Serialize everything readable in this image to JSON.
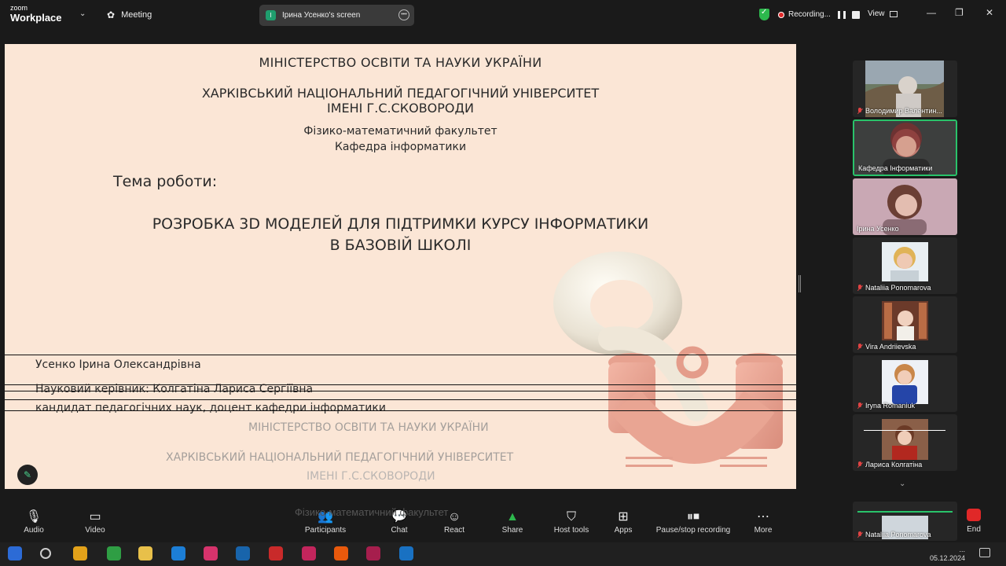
{
  "app": {
    "logo_line1": "zoom",
    "logo_line2": "Workplace",
    "meeting_label": "Meeting",
    "screen_share_badge": "I",
    "screen_share_label": "Ірина Усенко's screen",
    "recording_label": "Recording...",
    "view_label": "View",
    "accent_green": "#29c36a",
    "record_red": "#e02828"
  },
  "slide": {
    "ministry": "МІНІСТЕРСТВО ОСВІТИ ТА НАУКИ УКРАЇНИ",
    "university_line1": "ХАРКІВСЬКИЙ НАЦІОНАЛЬНИЙ ПЕДАГОГІЧНИЙ УНІВЕРСИТЕТ",
    "university_line2": "ІМЕНІ Г.С.СКОВОРОДИ",
    "faculty": "Фізико-математичний факультет",
    "department": "Кафедра інформатики",
    "topic_label": "Тема роботи:",
    "topic_line1": "РОЗРОБКА 3D МОДЕЛЕЙ ДЛЯ ПІДТРИМКИ КУРСУ   ІНФОРМАТИКИ",
    "topic_line2": "В БАЗОВІЙ ШКОЛІ",
    "author": "Усенко Ірина Олександрівна",
    "supervisor": "Науковий керівник: Колгатіна Лариса Сергіївна",
    "supervisor_title": "кандидат педагогічних наук, доцент кафедри інформатики",
    "ghost_ministry": "МІНІСТЕРСТВО ОСВІТИ ТА НАУКИ УКРАЇНИ",
    "ghost_university": "ХАРКІВСЬКИЙ НАЦІОНАЛЬНИЙ ПЕДАГОГІЧНИЙ УНІВЕРСИТЕТ",
    "ghost_named": "ІМЕНІ Г.С.СКОВОРОДИ"
  },
  "participants": [
    {
      "name": "Володимир Валентин...",
      "muted": true
    },
    {
      "name": "Кафедра Інформатики",
      "muted": false,
      "active": true
    },
    {
      "name": "Ірина Усенко",
      "muted": false
    },
    {
      "name": "Nataliia Ponomarova",
      "muted": true
    },
    {
      "name": "Vira Andriievska",
      "muted": true
    },
    {
      "name": "Iryna Romaniuk",
      "muted": true
    },
    {
      "name": "Лариса Колгатіна",
      "muted": true
    },
    {
      "name": "Nataliia Ponomarova",
      "muted": true
    }
  ],
  "toolbar": {
    "audio": "Audio",
    "video": "Video",
    "participants": "Participants",
    "participants_count": "20",
    "chat": "Chat",
    "react": "React",
    "share": "Share",
    "host_tools": "Host tools",
    "apps": "Apps",
    "pause_stop": "Pause/stop recording",
    "more": "More",
    "end": "End",
    "ghost_faculty": "Фізико-математичний факультет"
  },
  "taskbar": {
    "time": "...",
    "date": "05.12.2024"
  }
}
